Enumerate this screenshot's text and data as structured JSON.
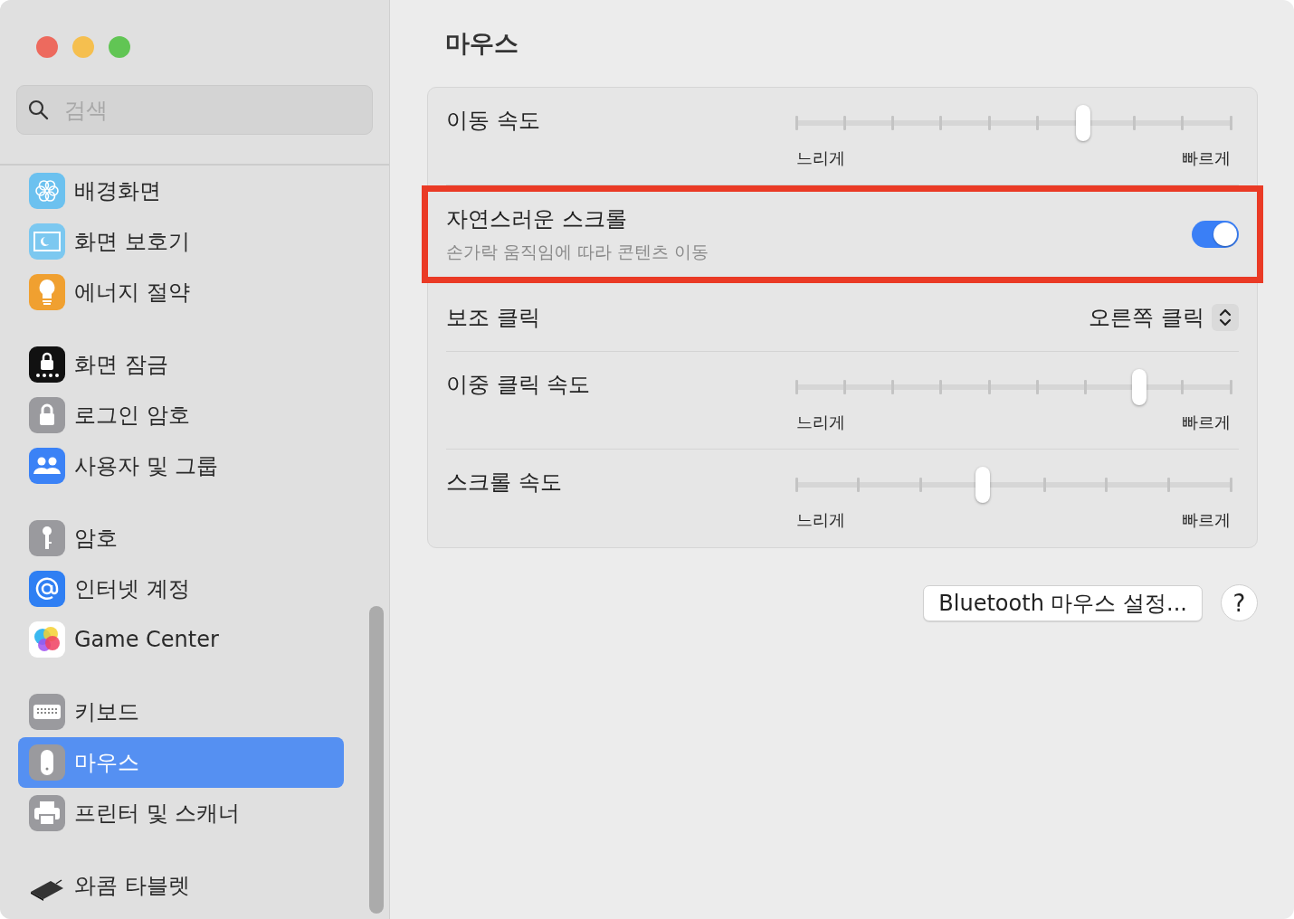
{
  "window": {
    "title": "마우스"
  },
  "search": {
    "placeholder": "검색"
  },
  "sidebar": {
    "groups": [
      [
        {
          "label": "배경화면",
          "selected": false
        },
        {
          "label": "화면 보호기",
          "selected": false
        },
        {
          "label": "에너지 절약",
          "selected": false
        }
      ],
      [
        {
          "label": "화면 잠금",
          "selected": false
        },
        {
          "label": "로그인 암호",
          "selected": false
        },
        {
          "label": "사용자 및 그룹",
          "selected": false
        }
      ],
      [
        {
          "label": "암호",
          "selected": false
        },
        {
          "label": "인터넷 계정",
          "selected": false
        },
        {
          "label": "Game Center",
          "selected": false
        }
      ],
      [
        {
          "label": "키보드",
          "selected": false
        },
        {
          "label": "마우스",
          "selected": true
        },
        {
          "label": "프린터 및 스캐너",
          "selected": false
        }
      ],
      [
        {
          "label": "와콤 타블렛",
          "selected": false
        }
      ]
    ]
  },
  "settings": [
    {
      "kind": "slider",
      "label": "이동 속도",
      "level": 0.66,
      "min_label": "느리게",
      "max_label": "빠르게"
    },
    {
      "kind": "toggle",
      "label": "자연스러운 스크롤",
      "description": "손가락 움직임에 따라 콘텐츠 이동",
      "on": true,
      "highlighted": true
    },
    {
      "kind": "popup",
      "label": "보조 클릭",
      "value": "오른쪽 클릭"
    },
    {
      "kind": "slider",
      "label": "이중 클릭 속도",
      "level": 0.79,
      "min_label": "느리게",
      "max_label": "빠르게"
    },
    {
      "kind": "slider",
      "label": "스크롤 속도",
      "level": 0.43,
      "min_label": "느리게",
      "max_label": "빠르게"
    }
  ],
  "buttons": {
    "bluetooth": "Bluetooth 마우스 설정...",
    "help": "?"
  }
}
